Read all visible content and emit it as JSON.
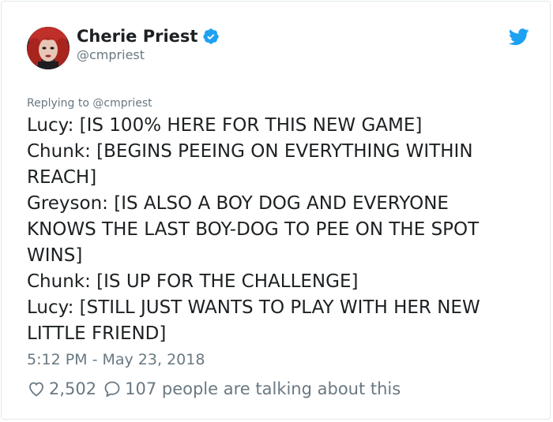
{
  "author": {
    "name": "Cherie Priest",
    "handle": "@cmpriest",
    "verified": true,
    "avatar_icon": "avatar-photo"
  },
  "reply": {
    "prefix": "Replying to ",
    "mention": "@cmpriest"
  },
  "tweet": {
    "lines": [
      "Lucy: [IS 100% HERE FOR THIS NEW GAME]",
      "Chunk: [BEGINS PEEING ON EVERYTHING WITHIN",
      "REACH]",
      "Greyson: [IS ALSO A BOY DOG AND EVERYONE",
      "KNOWS THE LAST BOY-DOG TO PEE ON THE SPOT",
      "WINS]",
      "Chunk: [IS UP FOR THE CHALLENGE]",
      "Lucy: [STILL JUST WANTS TO PLAY WITH HER NEW",
      "LITTLE FRIEND]"
    ]
  },
  "timestamp": "5:12 PM - May 23, 2018",
  "stats": {
    "likes": "2,502",
    "replies": "107 people are talking about this"
  },
  "colors": {
    "text": "#1c2022",
    "muted": "#697882",
    "twitter_blue": "#1da1f2",
    "border": "#e1e8ed"
  },
  "icons": {
    "verified": "verified-badge-icon",
    "brand": "twitter-bird-icon",
    "like": "heart-icon",
    "reply": "speech-bubble-icon"
  }
}
